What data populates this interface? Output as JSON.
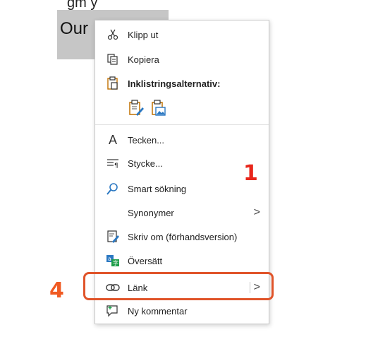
{
  "document": {
    "top_line": "gm                y",
    "selected_text": "Our"
  },
  "menu": {
    "cut": "Klipp ut",
    "copy": "Kopiera",
    "paste_options": "Inklistringsalternativ:",
    "font": "Tecken...",
    "paragraph": "Stycke...",
    "smart_lookup": "Smart sökning",
    "synonyms": "Synonymer",
    "rewrite": "Skriv om (förhandsversion)",
    "translate": "Översätt",
    "link": "Länk",
    "new_comment": "Ny kommentar",
    "chevron": ">"
  },
  "callouts": {
    "one": "1",
    "four": "4"
  },
  "colors": {
    "highlight": "#e0542a",
    "callout_one": "#e8261b",
    "callout_four": "#f05a22",
    "selection": "#c6c6c6"
  }
}
